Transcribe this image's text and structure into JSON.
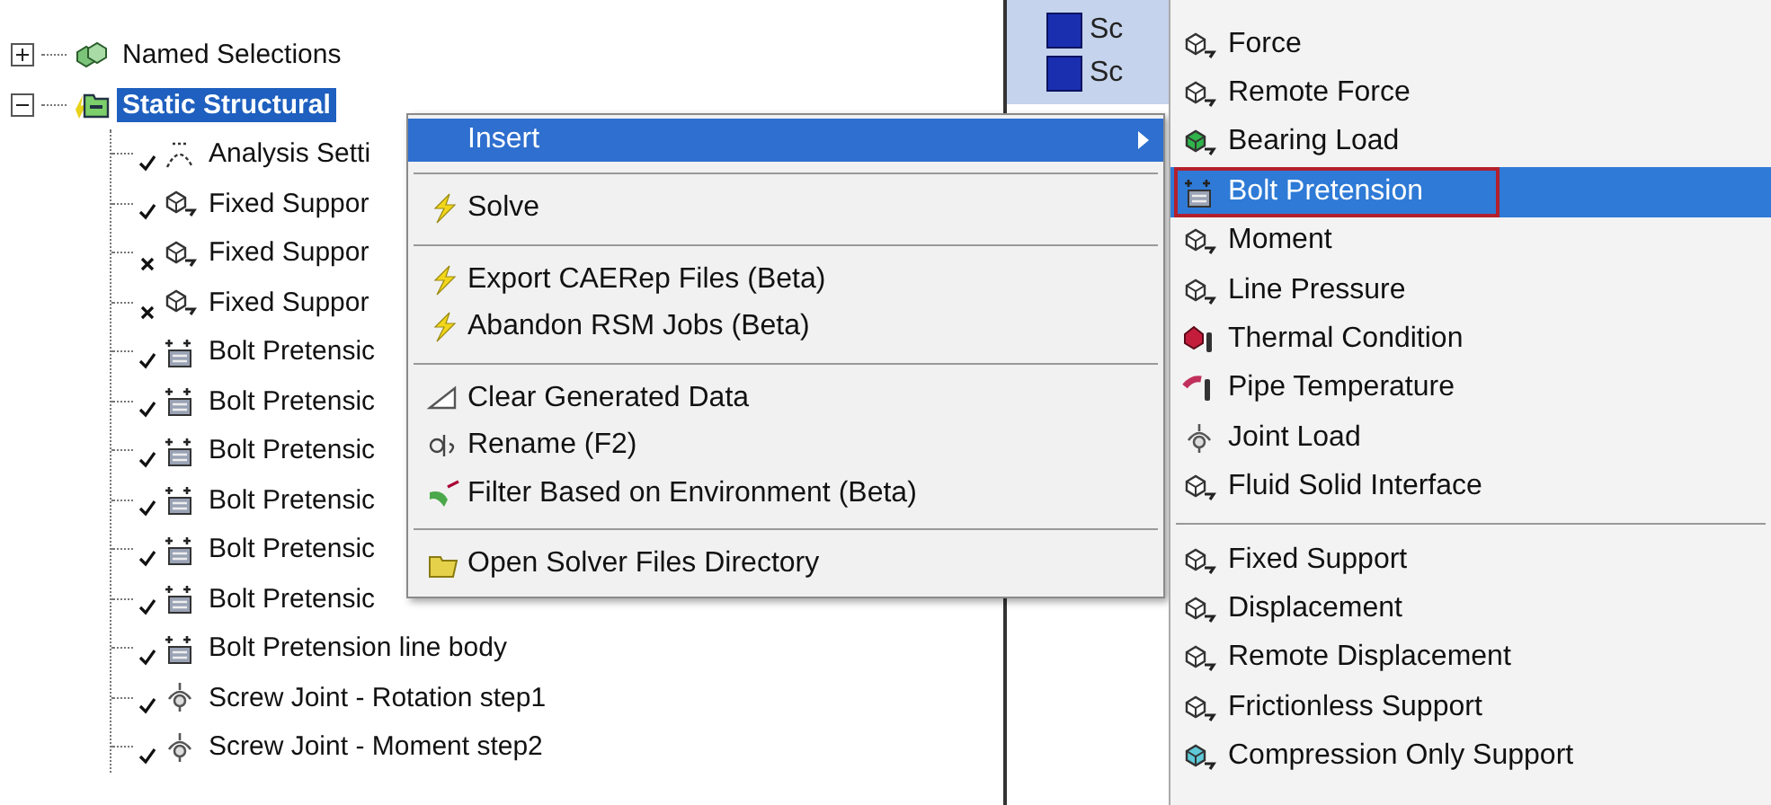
{
  "tree": {
    "items": [
      {
        "label": "Named Selections",
        "expanded": false,
        "selected": false
      },
      {
        "label": "Static Structural",
        "expanded": true,
        "selected": true,
        "children": [
          {
            "label": "Analysis Setti",
            "kind": "check",
            "selected": false
          },
          {
            "label": "Fixed Suppor",
            "kind": "check",
            "selected": false
          },
          {
            "label": "Fixed Suppor",
            "kind": "cross",
            "selected": false
          },
          {
            "label": "Fixed Suppor",
            "kind": "cross",
            "selected": false
          },
          {
            "label": "Bolt Pretensic",
            "kind": "check",
            "selected": false
          },
          {
            "label": "Bolt Pretensic",
            "kind": "check",
            "selected": false
          },
          {
            "label": "Bolt Pretensic",
            "kind": "check",
            "selected": false
          },
          {
            "label": "Bolt Pretensic",
            "kind": "check",
            "selected": false
          },
          {
            "label": "Bolt Pretensic",
            "kind": "check",
            "selected": false
          },
          {
            "label": "Bolt Pretensic",
            "kind": "check",
            "selected": false
          },
          {
            "label": "Bolt Pretension line body",
            "kind": "check",
            "selected": false
          },
          {
            "label": "Screw Joint - Rotation step1",
            "kind": "check",
            "selected": false
          },
          {
            "label": "Screw Joint - Moment step2",
            "kind": "check",
            "selected": false
          }
        ]
      }
    ]
  },
  "side_panel": {
    "items": [
      {
        "label": "Sc"
      },
      {
        "label": "Sc"
      }
    ]
  },
  "context_menu": {
    "groups": [
      [
        {
          "label": "Insert",
          "selected": true,
          "has_submenu": true
        }
      ],
      [
        {
          "label": "Solve",
          "selected": false,
          "has_submenu": false
        }
      ],
      [
        {
          "label": "Export CAERep Files (Beta)",
          "selected": false,
          "has_submenu": false
        },
        {
          "label": "Abandon RSM Jobs (Beta)",
          "selected": false,
          "has_submenu": false
        }
      ],
      [
        {
          "label": "Clear Generated Data",
          "selected": false,
          "has_submenu": false
        },
        {
          "label": "Rename (F2)",
          "selected": false,
          "has_submenu": false
        },
        {
          "label": "Filter Based on Environment (Beta)",
          "selected": false,
          "has_submenu": false
        }
      ],
      [
        {
          "label": "Open Solver Files Directory",
          "selected": false,
          "has_submenu": false
        }
      ]
    ]
  },
  "submenu": {
    "groups": [
      [
        {
          "label": "Force",
          "selected": false,
          "outlined": false
        },
        {
          "label": "Remote Force",
          "selected": false,
          "outlined": false
        },
        {
          "label": "Bearing Load",
          "selected": false,
          "outlined": false
        },
        {
          "label": "Bolt Pretension",
          "selected": true,
          "outlined": true
        },
        {
          "label": "Moment",
          "selected": false,
          "outlined": false
        },
        {
          "label": "Line Pressure",
          "selected": false,
          "outlined": false
        },
        {
          "label": "Thermal Condition",
          "selected": false,
          "outlined": false
        },
        {
          "label": "Pipe Temperature",
          "selected": false,
          "outlined": false
        },
        {
          "label": "Joint Load",
          "selected": false,
          "outlined": false
        },
        {
          "label": "Fluid Solid Interface",
          "selected": false,
          "outlined": false
        }
      ],
      [
        {
          "label": "Fixed Support",
          "selected": false,
          "outlined": false
        },
        {
          "label": "Displacement",
          "selected": false,
          "outlined": false
        },
        {
          "label": "Remote Displacement",
          "selected": false,
          "outlined": false
        },
        {
          "label": "Frictionless Support",
          "selected": false,
          "outlined": false
        },
        {
          "label": "Compression Only Support",
          "selected": false,
          "outlined": false
        }
      ]
    ]
  }
}
